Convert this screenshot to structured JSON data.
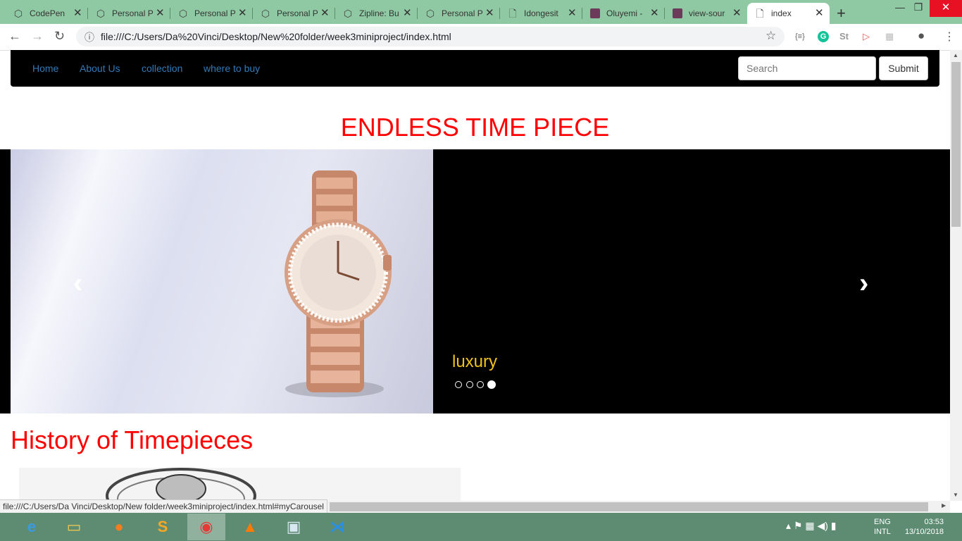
{
  "browser": {
    "tabs": [
      {
        "label": "CodePen",
        "icon": "codepen-icon"
      },
      {
        "label": "Personal P",
        "icon": "codepen-icon"
      },
      {
        "label": "Personal P",
        "icon": "codepen-icon"
      },
      {
        "label": "Personal P",
        "icon": "codepen-icon"
      },
      {
        "label": "Zipline: Bu",
        "icon": "codepen-icon"
      },
      {
        "label": "Personal P",
        "icon": "codepen-icon"
      },
      {
        "label": "Idongesit",
        "icon": "page-icon"
      },
      {
        "label": "Oluyemi -",
        "icon": "avatar-icon"
      },
      {
        "label": "view-sour",
        "icon": "avatar-icon"
      },
      {
        "label": "index",
        "icon": "page-icon"
      }
    ],
    "url": "file:///C:/Users/Da%20Vinci/Desktop/New%20folder/week3miniproject/index.html",
    "status_url": "file:///C:/Users/Da Vinci/Desktop/New folder/week3miniproject/index.html#myCarousel"
  },
  "page": {
    "nav": {
      "links": [
        "Home",
        "About Us",
        "collection",
        "where to buy"
      ],
      "search_placeholder": "Search",
      "submit_label": "Submit"
    },
    "heading": "ENDLESS TIME PIECE",
    "carousel": {
      "caption": "luxury",
      "active_index": 3,
      "indicator_count": 4,
      "prev_glyph": "‹",
      "next_glyph": "›"
    },
    "history_title": "History of Timepieces"
  },
  "taskbar": {
    "lang_top": "ENG",
    "lang_bottom": "INTL",
    "time": "03:53",
    "date": "13/10/2018"
  }
}
